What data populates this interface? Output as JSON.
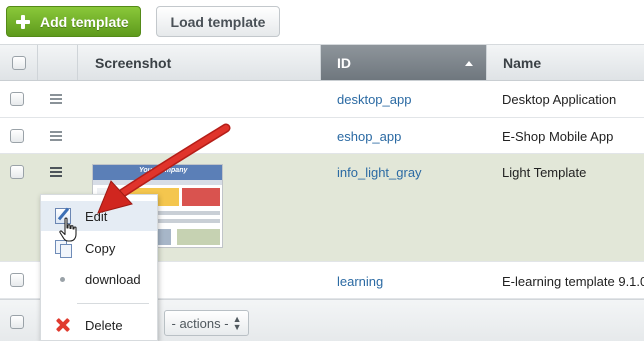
{
  "toolbar": {
    "add_label": "Add template",
    "load_label": "Load template"
  },
  "columns": {
    "screenshot": "Screenshot",
    "id": "ID",
    "name": "Name"
  },
  "rows": [
    {
      "id": "desktop_app",
      "name": "Desktop Application"
    },
    {
      "id": "eshop_app",
      "name": "E-Shop Mobile App"
    },
    {
      "id": "info_light_gray",
      "name": "Light Template"
    },
    {
      "id": "learning",
      "name": "E-learning template 9.1.0"
    }
  ],
  "context_menu": {
    "items": [
      {
        "label": "Edit",
        "icon": "edit-icon"
      },
      {
        "label": "Copy",
        "icon": "copy-icon"
      },
      {
        "label": "download",
        "icon": "bullet-icon"
      },
      {
        "label": "Delete",
        "icon": "delete-icon"
      }
    ]
  },
  "footer": {
    "actions_label": "- actions -"
  },
  "thumbnail": {
    "caption": "Your company"
  },
  "colors": {
    "accent_green": "#6fb02a",
    "selected_row": "#e2e7d8",
    "sorted_header": "#7c848a",
    "link": "#2b6aa3",
    "annotation_arrow": "#d0261f"
  }
}
